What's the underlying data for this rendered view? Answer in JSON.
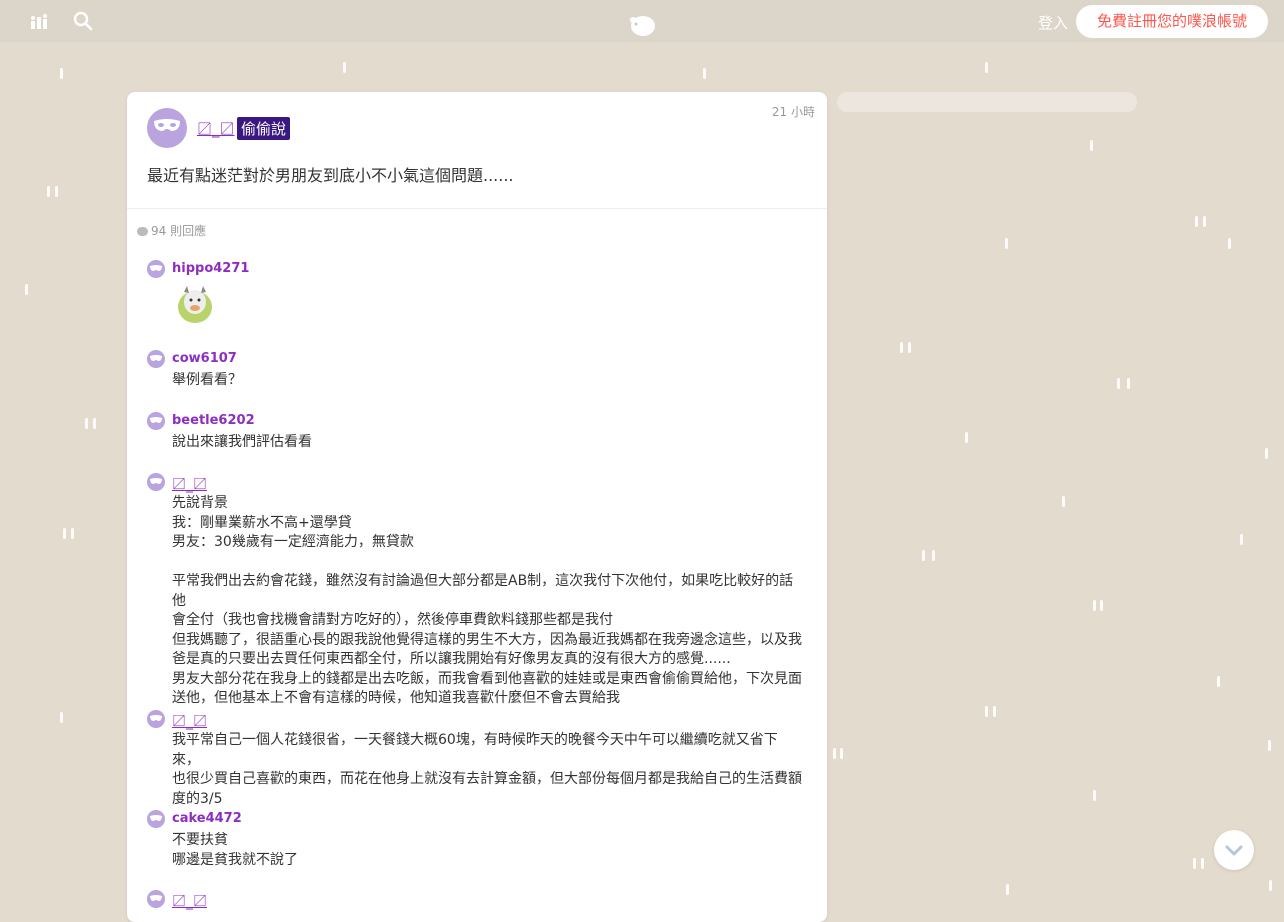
{
  "topbar": {
    "login": "登入",
    "signup": "免費註冊您的噗浪帳號"
  },
  "post": {
    "user": "〼_〼",
    "tag": "偷偷說",
    "time": "21 小時",
    "content": "最近有點迷茫對於男朋友到底小不小氣這個問題......",
    "response_count": "94 則回應"
  },
  "responses": [
    {
      "user": "hippo4271",
      "lines": []
    },
    {
      "user": "cow6107",
      "lines": [
        "舉例看看？"
      ]
    },
    {
      "user": "beetle6202",
      "lines": [
        "說出來讓我們評估看看"
      ]
    },
    {
      "user": "〼_〼",
      "lines": [
        "先說背景",
        "我：剛畢業薪水不高+還學貸",
        "男友：30幾歲有一定經濟能力，無貸款",
        "",
        "平常我們出去約會花錢，雖然沒有討論過但大部分都是AB制，這次我付下次他付，如果吃比較好的話他",
        "會全付（我也會找機會請對方吃好的），然後停車費飲料錢那些都是我付",
        "但我媽聽了，很語重心長的跟我說他覺得這樣的男生不大方，因為最近我媽都在我旁邊念這些，以及我",
        "爸是真的只要出去買任何東西都全付，所以讓我開始有好像男友真的沒有很大方的感覺......",
        "男友大部分花在我身上的錢都是出去吃飯，而我會看到他喜歡的娃娃或是東西會偷偷買給他，下次見面",
        "送他，但他基本上不會有這樣的時候，他知道我喜歡什麼但不會去買給我"
      ]
    },
    {
      "user": "〼_〼",
      "lines": [
        "我平常自己一個人花錢很省，一天餐錢大概60塊，有時候昨天的晚餐今天中午可以繼續吃就又省下來，",
        "也很少買自己喜歡的東西，而花在他身上就沒有去計算金額，但大部份每個月都是我給自己的生活費額",
        "度的3/5"
      ]
    },
    {
      "user": "cake4472",
      "lines": [
        "不要扶貧",
        "哪邊是貧我就不說了"
      ]
    },
    {
      "user": "〼_〼",
      "lines": []
    }
  ],
  "icons": {
    "stats": "stats-icon",
    "search": "search-icon",
    "logo": "plurk-logo-icon",
    "mask": "mask-icon",
    "sticker": "cow-sticker",
    "scroll": "chevron-down-icon"
  },
  "colors": {
    "background": "#e4dbcf",
    "topbar": "#dcd5c9",
    "username": "#8d2ec0",
    "tag_bg": "#3b1780",
    "signup_text": "#ff574d",
    "avatar": "#b9a4e0"
  }
}
